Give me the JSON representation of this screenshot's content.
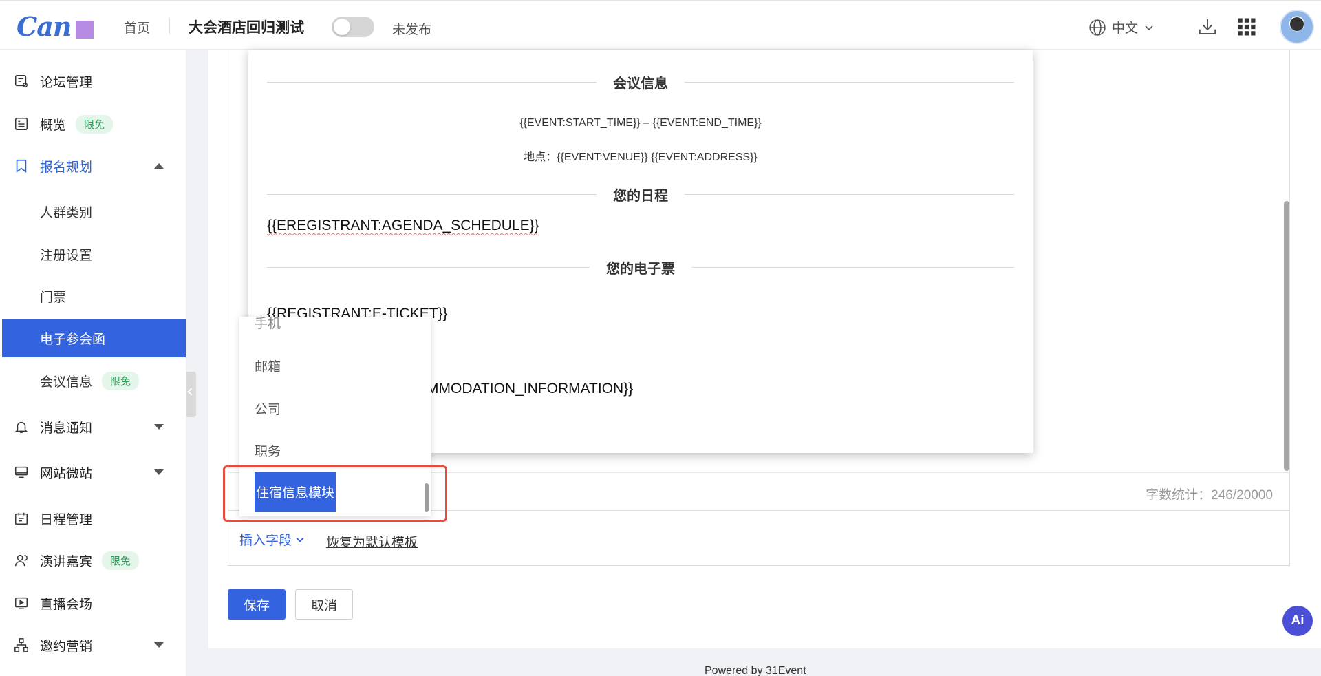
{
  "header": {
    "logo_text": "Can",
    "home": "首页",
    "event_name": "大会酒店回归测试",
    "publish_status": "未发布",
    "language": "中文"
  },
  "sidebar": {
    "items": [
      {
        "label": "论坛管理",
        "icon": "forum-icon"
      },
      {
        "label": "概览",
        "icon": "overview-icon",
        "badge": "限免"
      },
      {
        "label": "报名规划",
        "icon": "bookmark-icon",
        "expanded": true
      },
      {
        "label": "人群类别"
      },
      {
        "label": "注册设置"
      },
      {
        "label": "门票"
      },
      {
        "label": "电子参会函",
        "active": true
      },
      {
        "label": "会议信息",
        "badge": "限免"
      },
      {
        "label": "消息通知",
        "icon": "bell-icon"
      },
      {
        "label": "网站微站",
        "icon": "monitor-icon"
      },
      {
        "label": "日程管理",
        "icon": "calendar-icon"
      },
      {
        "label": "演讲嘉宾",
        "icon": "speaker-icon",
        "badge": "限免"
      },
      {
        "label": "直播会场",
        "icon": "live-icon"
      },
      {
        "label": "邀约营销",
        "icon": "network-icon"
      }
    ]
  },
  "email": {
    "meeting_info_title": "会议信息",
    "time_line": "{{EVENT:START_TIME}} – {{EVENT:END_TIME}}",
    "venue_line": "地点：{{EVENT:VENUE}} {{EVENT:ADDRESS}}",
    "schedule_title": "您的日程",
    "schedule_var": "{{EREGISTRANT:AGENDA_SCHEDULE}}",
    "ticket_title": "您的电子票",
    "ticket_var": "{{REGISTRANT:E-TICKET}}",
    "accommodation_var_partial": "MMODATION_INFORMATION}}"
  },
  "editor": {
    "word_count": "字数统计：246/20000",
    "insert_field": "插入字段",
    "restore_default": "恢复为默认模板"
  },
  "dropdown": {
    "items": [
      "手机",
      "邮箱",
      "公司",
      "职务",
      "住宿信息模块"
    ],
    "selected": "住宿信息模块"
  },
  "actions": {
    "save": "保存",
    "cancel": "取消"
  },
  "footer": {
    "powered_by": "Powered by 31Event",
    "ai_label": "Ai"
  },
  "colors": {
    "primary": "#3463df",
    "highlight": "#e84a3c",
    "badge_text": "#2e9a5a",
    "badge_bg": "#e3f6e9"
  }
}
